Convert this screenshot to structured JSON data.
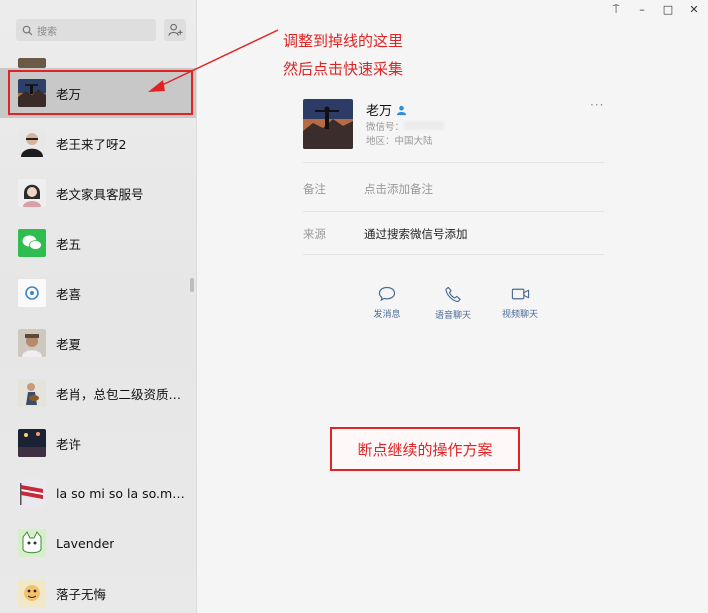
{
  "search": {
    "placeholder": "搜索"
  },
  "contacts": [
    {
      "name": "老万",
      "avatar": "mountain-sunset"
    },
    {
      "name": "老王来了呀2",
      "avatar": "man-glasses"
    },
    {
      "name": "老文家具客服号",
      "avatar": "girl-bob"
    },
    {
      "name": "老五",
      "avatar": "wechat-logo"
    },
    {
      "name": "老喜",
      "avatar": "blue-badge"
    },
    {
      "name": "老夏",
      "avatar": "man-cap"
    },
    {
      "name": "老肖，总包二级资质+...",
      "avatar": "guitarist"
    },
    {
      "name": "老许",
      "avatar": "concert"
    },
    {
      "name": "la so mi so la so.mi s...",
      "avatar": "flag"
    },
    {
      "name": "Lavender",
      "avatar": "cartoon-cat"
    },
    {
      "name": "落子无悔",
      "avatar": "cartoon-character"
    }
  ],
  "profile": {
    "name": "老万",
    "wechat_id_label": "微信号：",
    "region_label": "地区：",
    "region_value": "中国大陆",
    "more": "···",
    "remark_label": "备注",
    "remark_value": "点击添加备注",
    "source_label": "来源",
    "source_value": "通过搜索微信号添加"
  },
  "actions": [
    {
      "label": "发消息",
      "icon": "message-icon"
    },
    {
      "label": "语音聊天",
      "icon": "phone-icon"
    },
    {
      "label": "视频聊天",
      "icon": "video-icon"
    }
  ],
  "window_controls": {
    "pin": "⍑",
    "minimize": "–",
    "maximize": "□",
    "close": "✕"
  },
  "annotations": {
    "line1": "调整到掉线的这里",
    "line2": "然后点击快速采集",
    "box": "断点继续的操作方案"
  },
  "colors": {
    "annotation_red": "#e02424",
    "link_blue": "#4a6b94",
    "selected_bg": "#c8c8c8"
  }
}
